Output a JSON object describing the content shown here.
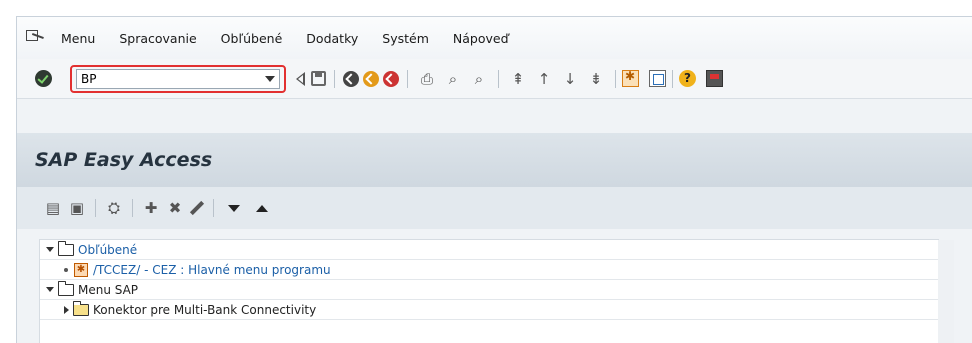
{
  "menubar": {
    "items": [
      {
        "label": "Menu"
      },
      {
        "label": "Spracovanie"
      },
      {
        "label": "Obľúbené"
      },
      {
        "label": "Dodatky"
      },
      {
        "label": "Systém"
      },
      {
        "label": "Nápoveď"
      }
    ]
  },
  "toolbar": {
    "command_value": "BP"
  },
  "title": "SAP Easy Access",
  "tree": {
    "rows": [
      {
        "label": "Obľúbené"
      },
      {
        "label": "/TCCEZ/ - CEZ : Hlavné menu programu"
      },
      {
        "label": "Menu SAP"
      },
      {
        "label": "Konektor pre Multi-Bank Connectivity"
      }
    ]
  },
  "icons": {
    "menu_icon": "exit-menu-icon",
    "enter": "check-icon",
    "back": "back-icon",
    "save": "save-icon"
  },
  "colors": {
    "highlight_border": "#e23030",
    "link_blue": "#1b5fa7"
  }
}
